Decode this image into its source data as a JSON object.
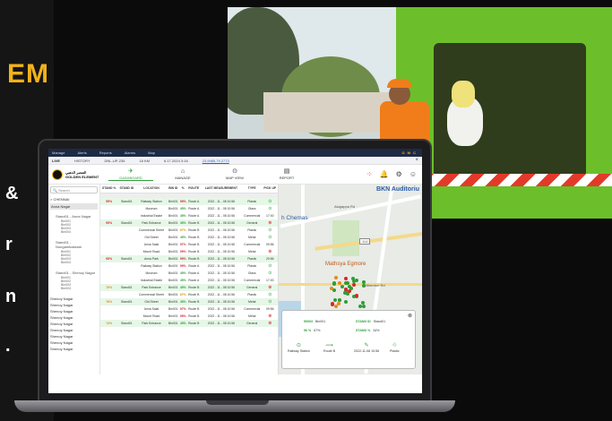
{
  "marketing": {
    "brand_fragment": "EM",
    "side_fragments": [
      "&",
      "r",
      "n",
      "."
    ]
  },
  "app": {
    "topbar": [
      "Manage",
      "Alerts",
      "Reports",
      "Alarms",
      "Map"
    ],
    "topbar_logo": "O M C",
    "status": {
      "live": "LIVE",
      "history": "HISTORY",
      "vehicle": "DNL-UP-236",
      "speed": "18 KM",
      "datetime": "6.17.2024 3:16",
      "coords": "23.9985,79.2773",
      "close": "×"
    },
    "logo_text_ar": "العنصر الذهبي",
    "logo_text_en": "GOLDEN ELEMENT",
    "nav": [
      {
        "label": "DASHBOARD",
        "icon": "✈"
      },
      {
        "label": "MANAGE",
        "icon": "⌂"
      },
      {
        "label": "MAP VIEW",
        "icon": "⊙"
      },
      {
        "label": "REPORT",
        "icon": "▤"
      }
    ],
    "nav_icons_right": [
      "⁘",
      "🔔",
      "⚙",
      "☺"
    ]
  },
  "sidebar": {
    "search_placeholder": "Search",
    "region": "> CHENNAI",
    "selected": "Anna Nagar",
    "groups": [
      {
        "title": "Stand01 - Anna Nagar",
        "items": [
          "Bin001",
          "Bin002",
          "Bin003",
          "Bin004"
        ]
      },
      {
        "title": "Stand01 - Nungambakkam",
        "items": [
          "Bin001",
          "Bin002",
          "Bin003",
          "Bin004"
        ]
      },
      {
        "title": "Stand01 - Shenoy Nagar",
        "items": [
          "Bin001",
          "Bin002",
          "Bin003",
          "Bin004"
        ]
      }
    ],
    "bottom": [
      "Shenoy Nagar",
      "Shenoy Nagar",
      "Shenoy Nagar",
      "Shenoy Nagar",
      "Shenoy Nagar",
      "Shenoy Nagar",
      "Shenoy Nagar",
      "Shenoy Nagar",
      "Shenoy Nagar"
    ]
  },
  "table": {
    "headers": [
      "STAND %",
      "STAND ID",
      "LOCATION",
      "BIN ID",
      "%",
      "ROUTE",
      "LAST MEASUREMENT",
      "TYPE",
      "PICK UP"
    ],
    "rows": [
      {
        "stand_pct": "95%",
        "stand_id": "Stand01",
        "location": "Railway Station",
        "bin": "Bin001",
        "pct": "99%",
        "route": "Route A",
        "last": "2022 - 11 - 08 10:56",
        "type": "Plastic",
        "pick": "ok",
        "group": true
      },
      {
        "stand_pct": "",
        "stand_id": "",
        "location": "Museum",
        "bin": "Bin001",
        "pct": "45%",
        "route": "Route A",
        "last": "2022 - 11 - 08 10:56",
        "type": "Glass",
        "pick": "ok",
        "group": false
      },
      {
        "stand_pct": "",
        "stand_id": "",
        "location": "Industrial Estate",
        "bin": "Bin001",
        "pct": "45%",
        "route": "Route A",
        "last": "2022 - 11 - 08 10:56",
        "type": "Commercial",
        "pick": "17:00",
        "group": false
      },
      {
        "stand_pct": "95%",
        "stand_id": "Stand01",
        "location": "Park Entrance",
        "bin": "Bin001",
        "pct": "45%",
        "route": "Route B",
        "last": "2022 - 11 - 08 10:56",
        "type": "General",
        "pick": "bad",
        "group": true
      },
      {
        "stand_pct": "",
        "stand_id": "",
        "location": "Commercial Street",
        "bin": "Bin001",
        "pct": "67%",
        "route": "Route B",
        "last": "2022 - 11 - 08 10:56",
        "type": "Plastic",
        "pick": "ok",
        "group": false
      },
      {
        "stand_pct": "",
        "stand_id": "",
        "location": "Old Street",
        "bin": "Bin001",
        "pct": "45%",
        "route": "Route B",
        "last": "2022 - 11 - 08 10:56",
        "type": "Metal",
        "pick": "ok",
        "group": false
      },
      {
        "stand_pct": "",
        "stand_id": "",
        "location": "Anna Salai",
        "bin": "Bin001",
        "pct": "97%",
        "route": "Route B",
        "last": "2022 - 11 - 08 10:56",
        "type": "Commercial",
        "pick": "09:56",
        "group": false
      },
      {
        "stand_pct": "",
        "stand_id": "",
        "location": "Mount Road",
        "bin": "Bin001",
        "pct": "99%",
        "route": "Route B",
        "last": "2022 - 11 - 08 10:56",
        "type": "Metal",
        "pick": "bad",
        "group": false
      },
      {
        "stand_pct": "95%",
        "stand_id": "Stand01",
        "location": "Anna Park",
        "bin": "Bin001",
        "pct": "99%",
        "route": "Route B",
        "last": "2022 - 11 - 08 10:56",
        "type": "Plastic",
        "pick": "20:56",
        "group": true
      },
      {
        "stand_pct": "",
        "stand_id": "",
        "location": "Railway Station",
        "bin": "Bin001",
        "pct": "99%",
        "route": "Route A",
        "last": "2022 - 11 - 08 10:56",
        "type": "Plastic",
        "pick": "ok",
        "group": false
      },
      {
        "stand_pct": "",
        "stand_id": "",
        "location": "Museum",
        "bin": "Bin001",
        "pct": "45%",
        "route": "Route A",
        "last": "2022 - 11 - 08 10:56",
        "type": "Glass",
        "pick": "ok",
        "group": false
      },
      {
        "stand_pct": "",
        "stand_id": "",
        "location": "Industrial Estate",
        "bin": "Bin001",
        "pct": "45%",
        "route": "Route A",
        "last": "2022 - 11 - 08 10:56",
        "type": "Commercial",
        "pick": "17:00",
        "group": false
      },
      {
        "stand_pct": "76%",
        "stand_id": "Stand01",
        "location": "Park Entrance",
        "bin": "Bin001",
        "pct": "45%",
        "route": "Route B",
        "last": "2022 - 11 - 08 10:56",
        "type": "General",
        "pick": "bad",
        "group": true
      },
      {
        "stand_pct": "",
        "stand_id": "",
        "location": "Commercial Street",
        "bin": "Bin001",
        "pct": "67%",
        "route": "Route B",
        "last": "2022 - 11 - 08 10:56",
        "type": "Plastic",
        "pick": "ok",
        "group": false
      },
      {
        "stand_pct": "76%",
        "stand_id": "Stand01",
        "location": "Old Street",
        "bin": "Bin001",
        "pct": "45%",
        "route": "Route B",
        "last": "2022 - 11 - 08 10:56",
        "type": "Metal",
        "pick": "ok",
        "group": true
      },
      {
        "stand_pct": "",
        "stand_id": "",
        "location": "Anna Salai",
        "bin": "Bin001",
        "pct": "97%",
        "route": "Route B",
        "last": "2022 - 11 - 08 10:56",
        "type": "Commercial",
        "pick": "09:56",
        "group": false
      },
      {
        "stand_pct": "",
        "stand_id": "",
        "location": "Mount Road",
        "bin": "Bin001",
        "pct": "99%",
        "route": "Route B",
        "last": "2022 - 11 - 08 10:56",
        "type": "Metal",
        "pick": "bad",
        "group": false
      },
      {
        "stand_pct": "74%",
        "stand_id": "Stand01",
        "location": "Park Entrance",
        "bin": "Bin001",
        "pct": "45%",
        "route": "Route B",
        "last": "2022 - 11 - 08 10:56",
        "type": "General",
        "pick": "bad",
        "group": true
      }
    ]
  },
  "map": {
    "labels": {
      "bkn": "BKN Auditoriu",
      "cinemas": "h Chemas",
      "mathsya": "Mathsya Egmore",
      "road1": "Alagappa Rd",
      "road2": "Ritherdon Rd",
      "badge": "114"
    },
    "popup": {
      "r1": [
        "90003",
        "Bin001",
        "STAND ID",
        "Stand01"
      ],
      "r2": [
        "96 %",
        "67%",
        "STAND %",
        "34%"
      ],
      "cells": [
        {
          "icon": "⊙",
          "label": "Railway Station"
        },
        {
          "icon": "⟿",
          "label": "Route B"
        },
        {
          "icon": "✎",
          "label": "2022-11-08 10:56"
        },
        {
          "icon": "♲",
          "label": "Plastic"
        }
      ],
      "close": "⊗"
    }
  }
}
